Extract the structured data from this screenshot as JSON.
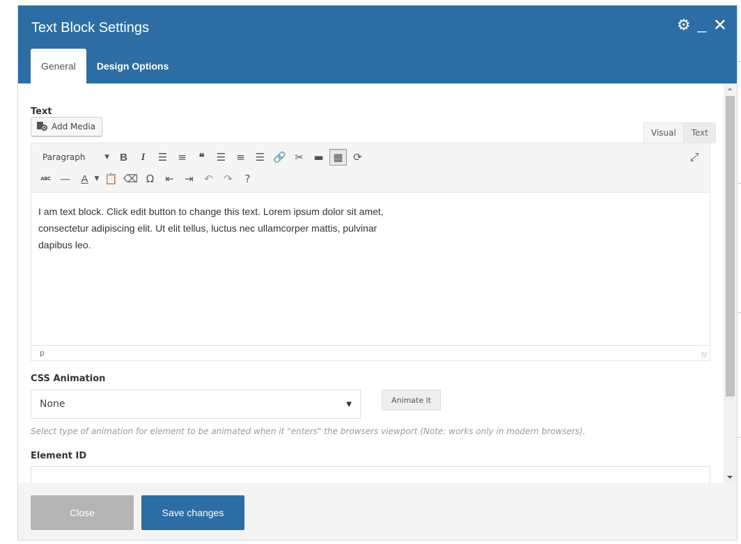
{
  "modal": {
    "title": "Text Block Settings",
    "tabs": [
      {
        "label": "General",
        "active": true
      },
      {
        "label": "Design Options",
        "active": false
      }
    ]
  },
  "text_field": {
    "label": "Text",
    "add_media_label": "Add Media",
    "editor_tabs": [
      {
        "label": "Visual",
        "active": true
      },
      {
        "label": "Text",
        "active": false
      }
    ],
    "format_select": "Paragraph",
    "toolbar_row1": [
      "B",
      "I",
      "≣",
      "⅓",
      "❝",
      "☰",
      "≡",
      "☷",
      "🔗",
      "⛓",
      "▬",
      "⌨",
      "⟳"
    ],
    "content": "I am text block. Click edit button to change this text. Lorem ipsum dolor sit amet, consectetur adipiscing elit. Ut elit tellus, luctus nec ullamcorper mattis, pulvinar dapibus leo.",
    "status_path": "p"
  },
  "css_animation": {
    "label": "CSS Animation",
    "selected": "None",
    "animate_button": "Animate it",
    "help_text": "Select type of animation for element to be animated when it \"enters\" the browsers viewport (Note: works only in modern browsers)."
  },
  "element_id": {
    "label": "Element ID",
    "value": ""
  },
  "footer": {
    "close_label": "Close",
    "save_label": "Save changes"
  },
  "colors": {
    "header_bg": "#2c6ea4",
    "save_btn": "#2c6ea4",
    "close_btn": "#b4b4b4"
  },
  "icons": [
    "gear-icon",
    "minimize-icon",
    "close-icon",
    "add-media-icon",
    "fullscreen-icon",
    "resize-grip-icon"
  ]
}
